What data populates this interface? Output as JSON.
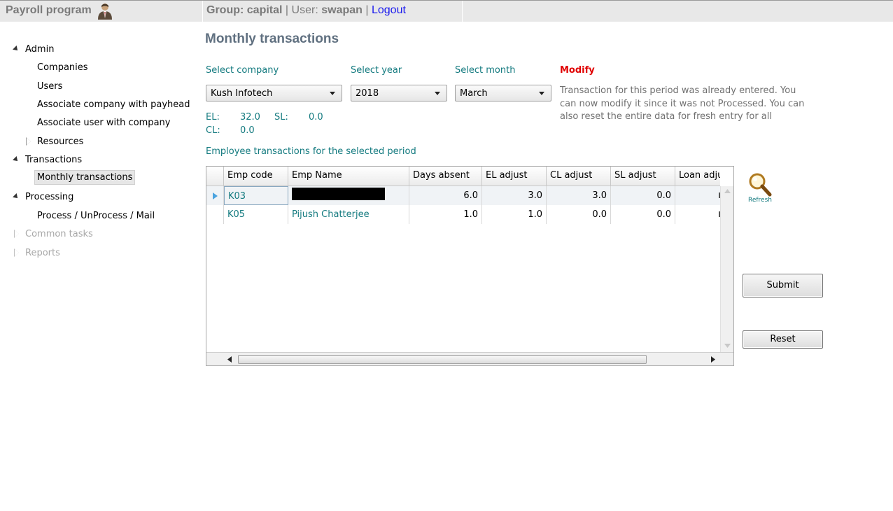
{
  "header": {
    "app_title": "Payroll program",
    "group_label": "Group:",
    "group_value": "capital",
    "divider": "|",
    "user_label": "User:",
    "user_value": "swapan",
    "divider2": "|",
    "logout": "Logout"
  },
  "sidebar": {
    "admin": "Admin",
    "companies": "Companies",
    "users": "Users",
    "assoc_company": "Associate company with payhead",
    "assoc_user": "Associate user with company",
    "resources": "Resources",
    "transactions": "Transactions",
    "monthly_transactions": "Monthly transactions",
    "processing": "Processing",
    "process_mail": "Process / UnProcess / Mail",
    "common_tasks": "Common tasks",
    "reports": "Reports"
  },
  "main": {
    "title": "Monthly transactions",
    "select_company_label": "Select company",
    "select_company_value": "Kush Infotech",
    "select_year_label": "Select year",
    "select_year_value": "2018",
    "select_month_label": "Select month",
    "select_month_value": "March",
    "modify_label": "Modify",
    "info_text": "Transaction for this period was already entered. You can now modify it since it was not Processed. You can also reset the entire data for fresh entry for all",
    "leave": {
      "el_label": "EL:",
      "el_value": "32.0",
      "sl_label": "SL:",
      "sl_value": "0.0",
      "cl_label": "CL:",
      "cl_value": "0.0"
    },
    "grid_caption": "Employee transactions for the selected period",
    "grid": {
      "columns": [
        "Emp code",
        "Emp Name",
        "Days absent",
        "EL adjust",
        "CL adjust",
        "SL adjust",
        "Loan adju"
      ],
      "rows": [
        [
          "K03",
          "",
          "6.0",
          "3.0",
          "3.0",
          "0.0",
          ""
        ],
        [
          "K05",
          "Pijush Chatterjee",
          "1.0",
          "1.0",
          "0.0",
          "0.0",
          ""
        ]
      ]
    },
    "refresh_label": "Refresh",
    "submit_label": "Submit",
    "reset_label": "Reset"
  },
  "colors": {
    "teal_text": "#137a7f",
    "modify_red": "#e00000",
    "header_bg": "#e8e8e8",
    "title_slate": "#607080"
  }
}
